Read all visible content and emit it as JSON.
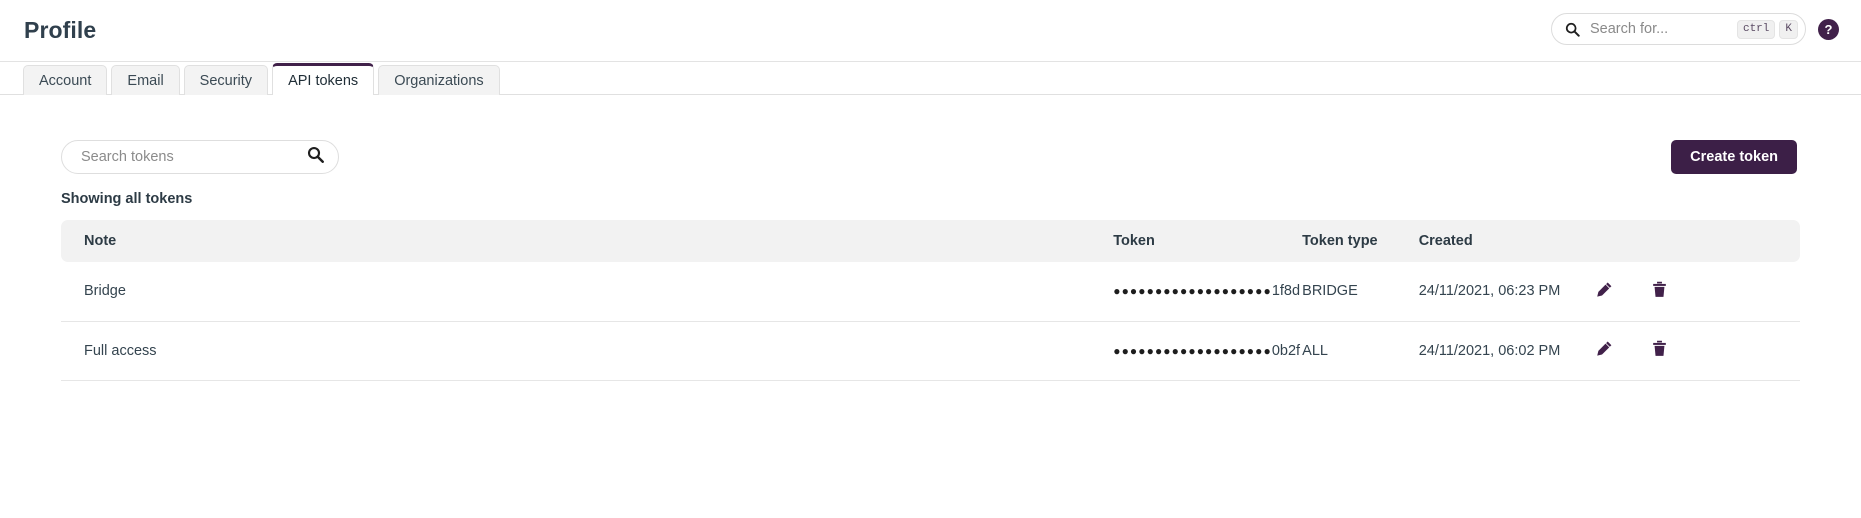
{
  "header": {
    "title": "Profile",
    "search": {
      "placeholder": "Search for...",
      "value": "",
      "icon": "search-icon",
      "shortcut_modifier": "ctrl",
      "shortcut_key": "K"
    },
    "help": {
      "label": "?",
      "icon": "help-circle-icon"
    }
  },
  "tabs": [
    {
      "label": "Account",
      "active": false
    },
    {
      "label": "Email",
      "active": false
    },
    {
      "label": "Security",
      "active": false
    },
    {
      "label": "API tokens",
      "active": true
    },
    {
      "label": "Organizations",
      "active": false
    }
  ],
  "toolbar": {
    "token_search": {
      "placeholder": "Search tokens",
      "value": "",
      "icon": "search-icon"
    },
    "create_label": "Create token"
  },
  "main": {
    "showing_label": "Showing all tokens",
    "table": {
      "columns": [
        "Note",
        "Token",
        "Token type",
        "Created",
        ""
      ],
      "rows": [
        {
          "note": "Bridge",
          "token_mask": "●●●●●●●●●●●●●●●●●●●",
          "token_tail": "1f8d",
          "token_type": "BRIDGE",
          "created": "24/11/2021, 06:23 PM",
          "edit_icon": "pencil-icon",
          "delete_icon": "trash-icon"
        },
        {
          "note": "Full access",
          "token_mask": "●●●●●●●●●●●●●●●●●●●",
          "token_tail": "0b2f",
          "token_type": "ALL",
          "created": "24/11/2021, 06:02 PM",
          "edit_icon": "pencil-icon",
          "delete_icon": "trash-icon"
        }
      ]
    }
  },
  "colors": {
    "brand_purple": "#41214a",
    "button_purple": "#3c1f47",
    "header_row_bg": "#f2f2f2",
    "text_dark": "#2d3b45",
    "border": "#e0e0e0"
  }
}
